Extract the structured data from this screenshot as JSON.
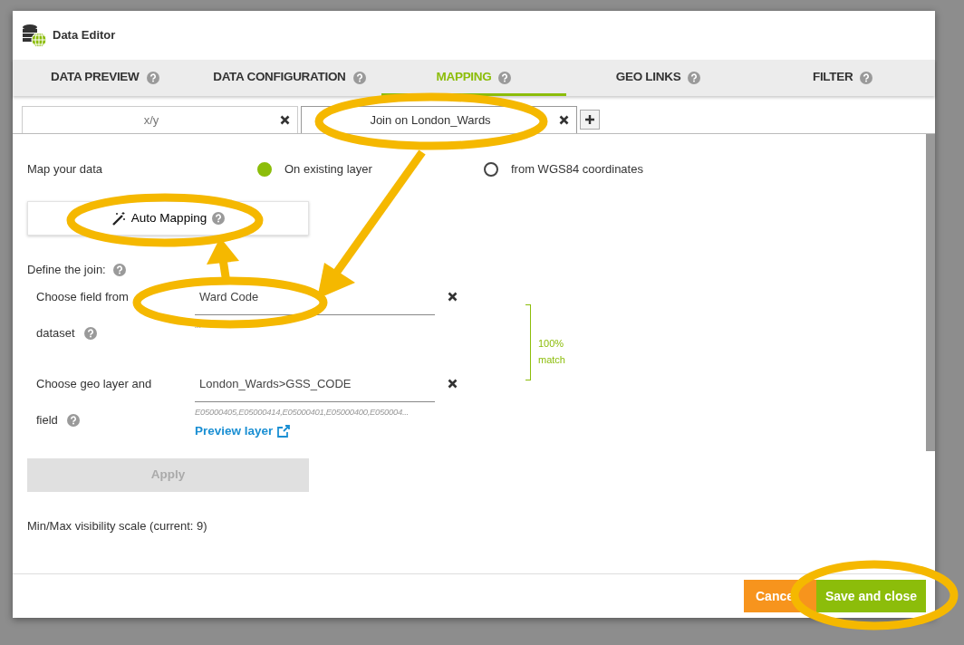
{
  "window": {
    "title": "Data Editor"
  },
  "tabs": [
    {
      "label": "DATA PREVIEW",
      "selected": false
    },
    {
      "label": "DATA CONFIGURATION",
      "selected": false
    },
    {
      "label": "MAPPING",
      "selected": true
    },
    {
      "label": "GEO LINKS",
      "selected": false
    },
    {
      "label": "FILTER",
      "selected": false
    }
  ],
  "layer_tabs": [
    {
      "label": "x/y",
      "selected": false
    },
    {
      "label": "Join on London_Wards",
      "selected": true
    }
  ],
  "map_your_data": {
    "label": "Map your data",
    "options": [
      {
        "label": "On existing layer",
        "selected": true
      },
      {
        "label": "from WGS84 coordinates",
        "selected": false
      }
    ]
  },
  "auto_mapping": {
    "label": "Auto Mapping"
  },
  "join": {
    "label": "Define the join:",
    "fields": [
      {
        "label_lines": [
          "Choose field from",
          "dataset"
        ],
        "value": "Ward Code",
        "sample": "..."
      },
      {
        "label_lines": [
          "Choose geo layer and",
          "field"
        ],
        "value": "London_Wards>GSS_CODE",
        "sample": "E05000405,E05000414,E05000401,E05000400,E050004...",
        "link": "Preview layer"
      }
    ],
    "match": "100% match"
  },
  "apply": {
    "label": "Apply",
    "disabled": true
  },
  "visibility": "Min/Max visibility scale (current: 9)",
  "footer": {
    "buttons": [
      {
        "label": "Cance",
        "kind": "cancel"
      },
      {
        "label": "Save and close",
        "kind": "save"
      }
    ]
  }
}
